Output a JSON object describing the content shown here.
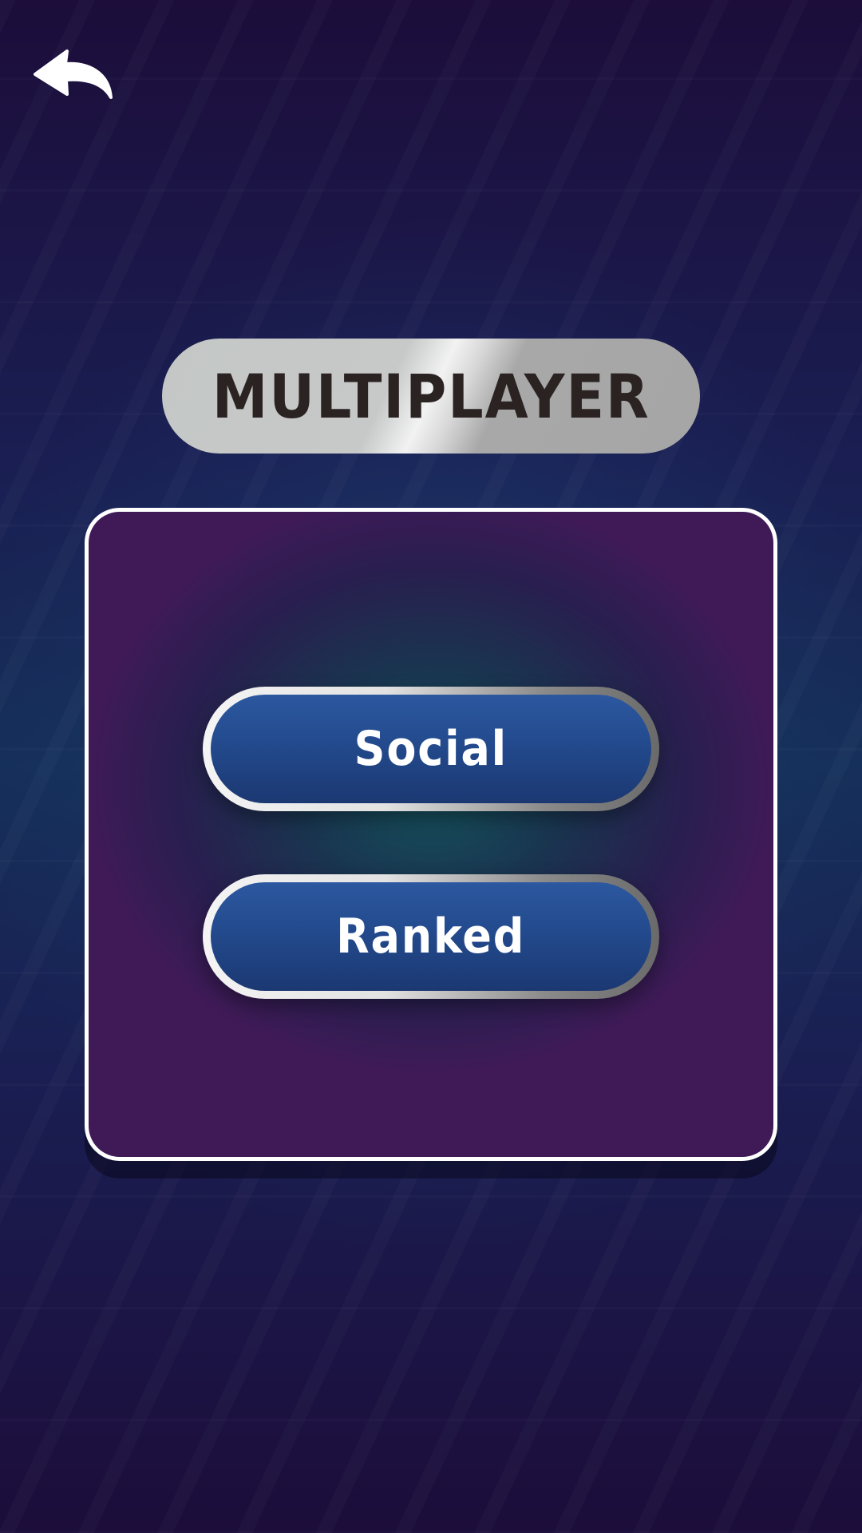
{
  "header": {
    "back_icon": "back-arrow-icon"
  },
  "title": {
    "text": "MULTIPLAYER"
  },
  "menu": {
    "buttons": [
      {
        "label": "Social"
      },
      {
        "label": "Ranked"
      }
    ]
  },
  "colors": {
    "button_blue": "#234a8d",
    "panel_border": "#ffffff",
    "title_text": "#2a2322",
    "background_dark": "#1c0d3a"
  }
}
